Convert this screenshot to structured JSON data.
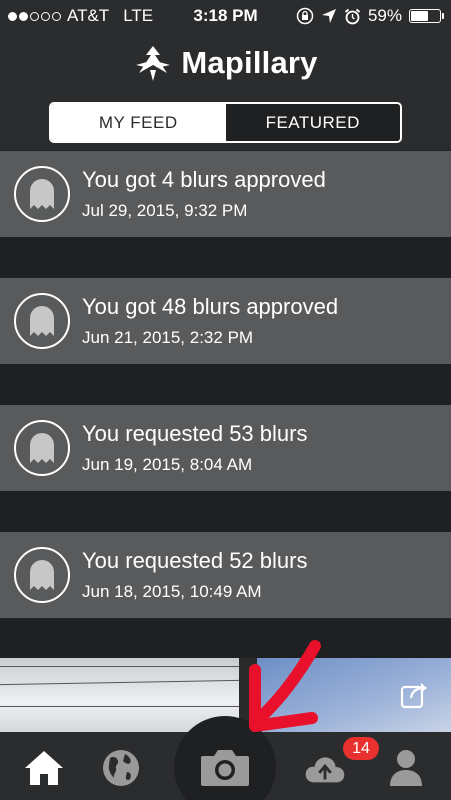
{
  "status_bar": {
    "carrier": "AT&T",
    "network": "LTE",
    "time": "3:18 PM",
    "battery": "59%",
    "battery_level": 0.59,
    "signal_bars": 2,
    "signal_total": 5
  },
  "header": {
    "app_name": "Mapillary",
    "logo_icon": "mapillary-logo-icon"
  },
  "tabs": [
    {
      "label": "MY FEED",
      "active": true
    },
    {
      "label": "FEATURED",
      "active": false
    }
  ],
  "feed": [
    {
      "title": "You got 4 blurs approved",
      "date": "Jul 29, 2015, 9:32 PM",
      "icon": "ghost-icon"
    },
    {
      "title": "You got 48 blurs approved",
      "date": "Jun 21, 2015, 2:32 PM",
      "icon": "ghost-icon"
    },
    {
      "title": "You requested 53 blurs",
      "date": "Jun 19, 2015, 8:04 AM",
      "icon": "ghost-icon"
    },
    {
      "title": "You requested 52 blurs",
      "date": "Jun 18, 2015, 10:49 AM",
      "icon": "ghost-icon"
    }
  ],
  "tab_bar": {
    "items": [
      "home-icon",
      "globe-icon",
      "camera-icon",
      "upload-cloud-icon",
      "profile-icon"
    ],
    "upload_badge": "14"
  },
  "colors": {
    "background": "#1f2022",
    "card": "#595a5b",
    "badge": "#e8312f",
    "annotation_arrow": "#e8102a"
  }
}
